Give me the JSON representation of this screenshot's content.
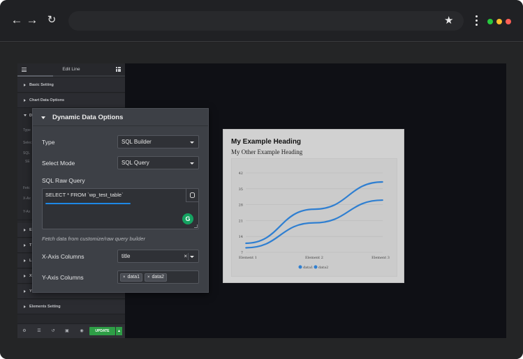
{
  "browser": {
    "back_icon": "arrow-left-icon",
    "forward_icon": "arrow-right-icon",
    "reload_icon": "reload-icon",
    "bookmark_icon": "star-icon",
    "menu_icon": "kebab-menu-icon",
    "window_dots": [
      "#27c93f",
      "#ffbd2e",
      "#ff5f56"
    ]
  },
  "editor": {
    "title": "Edit Line",
    "sections": [
      {
        "label": "Basic Setting"
      },
      {
        "label": "Chart Data Options"
      },
      {
        "label": "D"
      },
      {
        "label": "E"
      },
      {
        "label": "T"
      },
      {
        "label": "L"
      },
      {
        "label": "X"
      },
      {
        "label": "Y"
      },
      {
        "label": "Elements Setting"
      }
    ],
    "ghost_labels": [
      "Type",
      "Selec",
      "SQL",
      "SE",
      "Fetc",
      "X-Ax",
      "Y-Ax"
    ],
    "footer": {
      "update_label": "UPDATE",
      "icons": [
        "gear-icon",
        "layers-icon",
        "history-icon",
        "responsive-icon",
        "eye-icon"
      ]
    }
  },
  "popup": {
    "title": "Dynamic Data Options",
    "type_label": "Type",
    "type_value": "SQL Builder",
    "mode_label": "Select Mode",
    "mode_value": "SQL Query",
    "raw_query_label": "SQL Raw Query",
    "raw_query_value": "SELECT * FROM `wp_test_table`",
    "grammarly_glyph": "G",
    "hint": "Fetch data from customize/raw query builder",
    "x_label": "X-Axis Columns",
    "x_value": "title",
    "x_clear": "×",
    "y_label": "Y-Axis Columns",
    "y_tags": [
      "data1",
      "data2"
    ],
    "tag_remove": "×"
  },
  "card": {
    "heading": "My Example Heading",
    "subheading": "My Other Example Heading"
  },
  "chart_data": {
    "type": "line",
    "categories": [
      "Element 1",
      "Element 2",
      "Element 3"
    ],
    "series": [
      {
        "name": "data1",
        "color": "#2f7fd1",
        "values": [
          11,
          26,
          38
        ]
      },
      {
        "name": "data2",
        "color": "#2f7fd1",
        "values": [
          9,
          20,
          30
        ]
      }
    ],
    "y_ticks": [
      "7",
      "14",
      "21",
      "28",
      "35",
      "42"
    ],
    "ylim": [
      7,
      42
    ],
    "grid": true,
    "legend": "bottom"
  }
}
